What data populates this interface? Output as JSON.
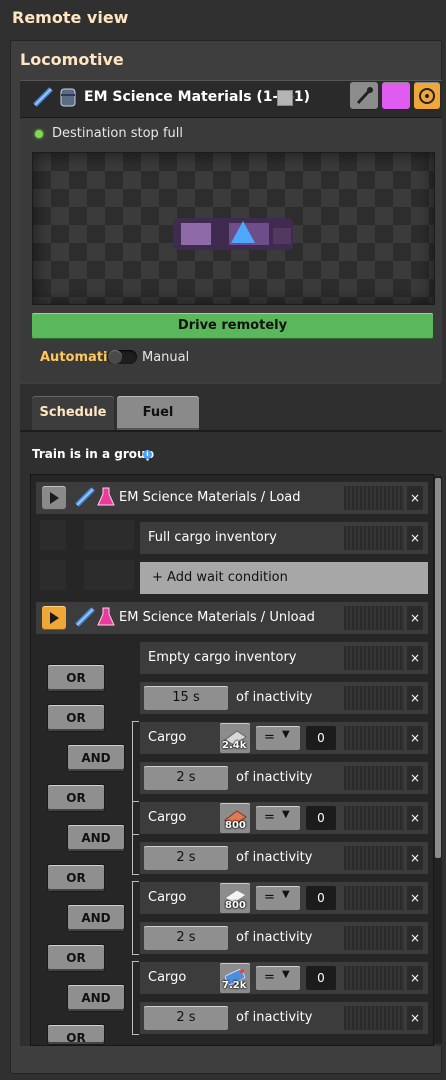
{
  "window": {
    "title": "Remote view"
  },
  "locomotive": {
    "heading": "Locomotive",
    "name": "EM Science Materials (1-4-1)",
    "status": "Destination stop full",
    "drive_label": "Drive remotely",
    "automatic_label": "Automatic",
    "manual_label": "Manual",
    "color_swatch": "#e05cf0"
  },
  "tabs": {
    "schedule": "Schedule",
    "fuel": "Fuel"
  },
  "group": {
    "text": "Train is in a group",
    "info_glyph": "i"
  },
  "schedule": {
    "stop1": {
      "label": "EM Science Materials / Load",
      "condition": "Full cargo inventory",
      "add_wait": "+ Add wait condition"
    },
    "stop2": {
      "label": "EM Science Materials / Unload",
      "empty_cond": "Empty cargo inventory",
      "inactivity_suffix": "of inactivity",
      "inact1": "15 s",
      "cargo_label": "Cargo",
      "cmp": "=",
      "value": "0",
      "inact_short": "2 s",
      "counts": [
        "2.4k",
        "800",
        "800",
        "7.2k"
      ]
    },
    "or_label": "OR",
    "and_label": "AND",
    "close": "×"
  }
}
